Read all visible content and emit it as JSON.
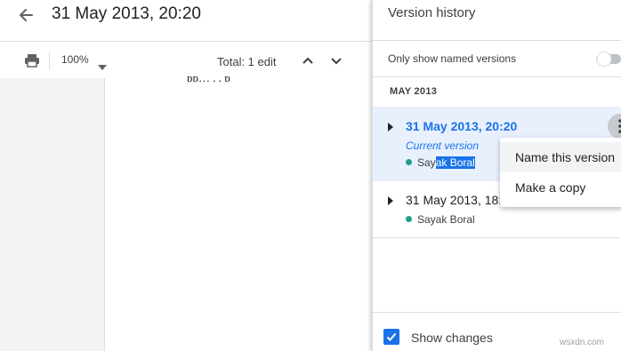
{
  "header": {
    "title": "31 May 2013, 20:20"
  },
  "toolbar": {
    "zoom": "100%",
    "total_edits": "Total: 1 edit"
  },
  "document": {
    "visible_text_fragment": "pp…      , ,         p"
  },
  "panel": {
    "title": "Version history",
    "named_only_label": "Only show named versions",
    "named_only_enabled": false,
    "month_label": "MAY 2013",
    "versions": [
      {
        "timestamp": "31 May 2013, 20:20",
        "badge": "Current version",
        "editor_plain": "Say",
        "editor_selected": "ak Boral",
        "selected": true
      },
      {
        "timestamp": "31 May 2013, 18:",
        "editor": "Sayak Boral",
        "selected": false
      }
    ],
    "show_changes_label": "Show changes",
    "show_changes_checked": true
  },
  "context_menu": {
    "items": [
      "Name this version",
      "Make a copy"
    ]
  },
  "colors": {
    "accent": "#1a73e8",
    "selected_bg": "#e8f0fe",
    "editor_dot": "#1e9e8b"
  },
  "watermark": "wsxdn.com"
}
